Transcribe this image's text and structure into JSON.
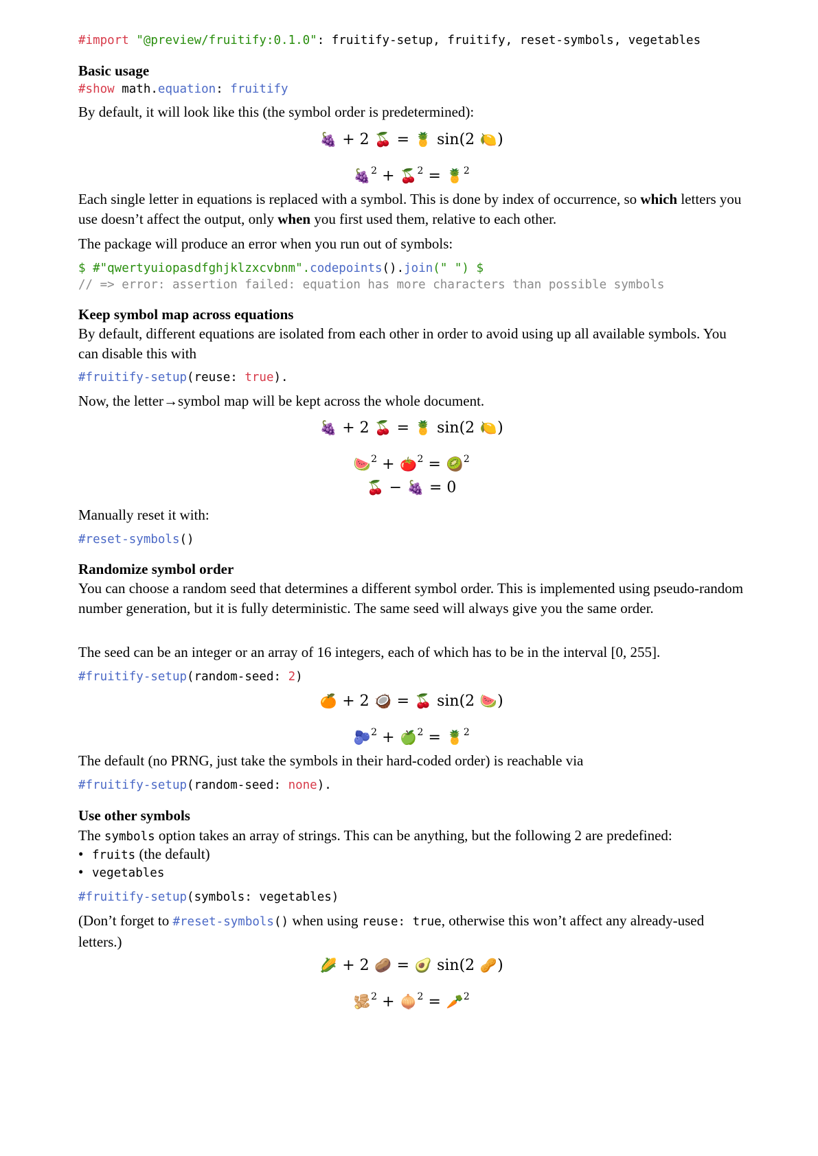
{
  "import_line": {
    "kw": "#import",
    "str": "\"@preview/fruitify:0.1.0\"",
    "rest": ": fruitify-setup, fruitify, reset-symbols, vegetables"
  },
  "basic": {
    "heading": "Basic usage",
    "code": {
      "kw": "#show",
      "a": " math.",
      "fn1": "equation",
      "b": ": ",
      "fn2": "fruitify"
    },
    "p1": "By default, it will look like this (the symbol order is predetermined):",
    "eq1": {
      "s1": "🍇",
      "t1": "+ 2",
      "s2": "🍒",
      "t2": "=",
      "s3": "🍍",
      "t3": "sin(2",
      "s4": "🍋",
      "t4": ")"
    },
    "eq2": {
      "s1": "🍇",
      "t1": "+",
      "s2": "🍒",
      "t2": "=",
      "s3": "🍍",
      "sup": "2"
    },
    "p2_a": "Each single letter in equations is replaced with a symbol. This is done by index of occurrence, so ",
    "p2_b": "which",
    "p2_c": " letters you use doesn’t affect the output, only ",
    "p2_d": "when",
    "p2_e": " you first used them, relative to each other.",
    "p3": "The package will produce an error when you run out of symbols:",
    "err_code": {
      "a": "$ #\"qwertyuiopasdfghjklzxcvbnm\".",
      "fn1": "codepoints",
      "b": "().",
      "fn2": "join",
      "c": "(\" \") $"
    },
    "err_comment": "// => error: assertion failed: equation has more characters than possible symbols"
  },
  "keep": {
    "heading": "Keep symbol map across equations",
    "p1": "By default, different equations are isolated from each other in order to avoid using up all available symbols. You can disable this with",
    "code": {
      "fn": "#fruitify-setup",
      "a": "(reuse: ",
      "val": "true",
      "b": ")."
    },
    "p2": "Now, the letter→symbol map will be kept across the whole document.",
    "eq1": {
      "s1": "🍇",
      "t1": "+ 2",
      "s2": "🍒",
      "t2": "=",
      "s3": "🍍",
      "t3": "sin(2",
      "s4": "🍋",
      "t4": ")"
    },
    "eq2": {
      "s1": "🍉",
      "t1": "+",
      "s2": "🍅",
      "t2": "=",
      "s3": "🥝",
      "sup": "2"
    },
    "eq3": {
      "s1": "🍒",
      "t1": "−",
      "s2": "🍇",
      "t2": "= 0"
    },
    "p3": "Manually reset it with:",
    "code2": {
      "fn": "#reset-symbols",
      "a": "()"
    }
  },
  "random": {
    "heading": "Randomize symbol order",
    "p1": "You can choose a random seed that determines a different symbol order. This is implemented using pseudo-random number generation, but it is fully deterministic. The same seed will always give you the same order.",
    "p2": "The seed can be an integer or an array of 16 integers, each of which has to be in the interval [0, 255].",
    "code": {
      "fn": "#fruitify-setup",
      "a": "(random-seed: ",
      "val": "2",
      "b": ")"
    },
    "eq1": {
      "s1": "🍊",
      "t1": "+ 2",
      "s2": "🥥",
      "t2": "=",
      "s3": "🍒",
      "t3": "sin(2",
      "s4": "🍉",
      "t4": ")"
    },
    "eq2": {
      "s1": "🫐",
      "t1": "+",
      "s2": "🍏",
      "t2": "=",
      "s3": "🍍",
      "sup": "2"
    },
    "p3": "The default (no PRNG, just take the symbols in their hard-coded order) is reachable via",
    "code2": {
      "fn": "#fruitify-setup",
      "a": "(random-seed: ",
      "val": "none",
      "b": ")."
    }
  },
  "other": {
    "heading": "Use other symbols",
    "p1_a": "The ",
    "p1_code": "symbols",
    "p1_b": " option takes an array of strings. This can be anything, but the following 2 are predefined:",
    "bullets": [
      {
        "code": "fruits",
        "text": " (the default)"
      },
      {
        "code": "vegetables",
        "text": ""
      }
    ],
    "code": {
      "fn": "#fruitify-setup",
      "a": "(symbols: vegetables)"
    },
    "p2_a": "(Don’t forget to ",
    "p2_fn": "#reset-symbols",
    "p2_paren": "()",
    "p2_b": " when using ",
    "p2_code": "reuse: true",
    "p2_c": ", otherwise this won’t affect any already-used letters.)",
    "eq1": {
      "s1": "🌽",
      "t1": "+ 2",
      "s2": "🥔",
      "t2": "=",
      "s3": "🥑",
      "t3": "sin(2",
      "s4": "🥜",
      "t4": ")"
    },
    "eq2": {
      "s1": "🫚",
      "t1": "+",
      "s2": "🧅",
      "t2": "=",
      "s3": "🥕",
      "sup": "2"
    },
    "bullet_char": "•"
  }
}
